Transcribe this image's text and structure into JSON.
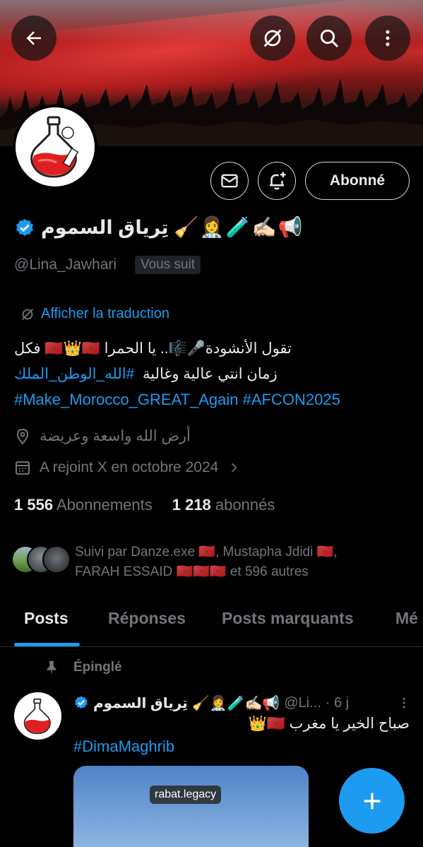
{
  "profile": {
    "name": "تِرياق السموم",
    "name_emojis": [
      "🧹",
      "👩‍⚕️",
      "🧪",
      "✍🏻",
      "📢"
    ],
    "handle": "@Lina_Jawhari",
    "follows_you": "Vous suit",
    "follow_button": "Abonné",
    "translate_link": "Afficher la traduction",
    "bio_line1": "تقول الأنشودة🎤🎼.. يا الحمرا 🇲🇦👑🇲🇦 فكل",
    "bio_line2_text": "زمان انتي عالية وغالية",
    "bio_line2_tag": "#الله_الوطن_الملك",
    "bio_line3": "#Make_Morocco_GREAT_Again #AFCON2025",
    "location": "أرض الله واسعة وعريضة",
    "joined": "A rejoint X en octobre 2024",
    "following_count": "1 556",
    "following_label": "Abonnements",
    "followers_count": "1 218",
    "followers_label": "abonnés",
    "followed_by_line1": "Suivi par Danze.exe 🇲🇦, Mustapha Jdidi 🇲🇦,",
    "followed_by_line2": "FARAH ESSAID 🇲🇦🇲🇦🇲🇦 et 596 autres"
  },
  "tabs": [
    {
      "label": "Posts"
    },
    {
      "label": "Réponses"
    },
    {
      "label": "Posts marquants"
    },
    {
      "label": "Mé"
    }
  ],
  "pinned_post": {
    "pinned_label": "Épinglé",
    "author_name": "تِرياق السموم",
    "author_emojis": "🧹👩‍⚕️🧪✍🏻📢",
    "handle": "@Li...",
    "time": "· 6 j",
    "text": "صباح الخير يا مغرب 🇲🇦👑",
    "hashtag": "#DimaMaghrib",
    "media_tag": "rabat.legacy"
  },
  "colors": {
    "accent": "#1d9bf0",
    "secondary_text": "#71767b",
    "background": "#000000"
  },
  "icons": [
    "back-arrow-icon",
    "translate-off-icon",
    "search-icon",
    "more-vertical-icon",
    "mail-icon",
    "bell-add-icon",
    "verified-badge-icon",
    "location-pin-icon",
    "calendar-icon",
    "chevron-right-icon",
    "pin-icon",
    "plus-icon"
  ]
}
